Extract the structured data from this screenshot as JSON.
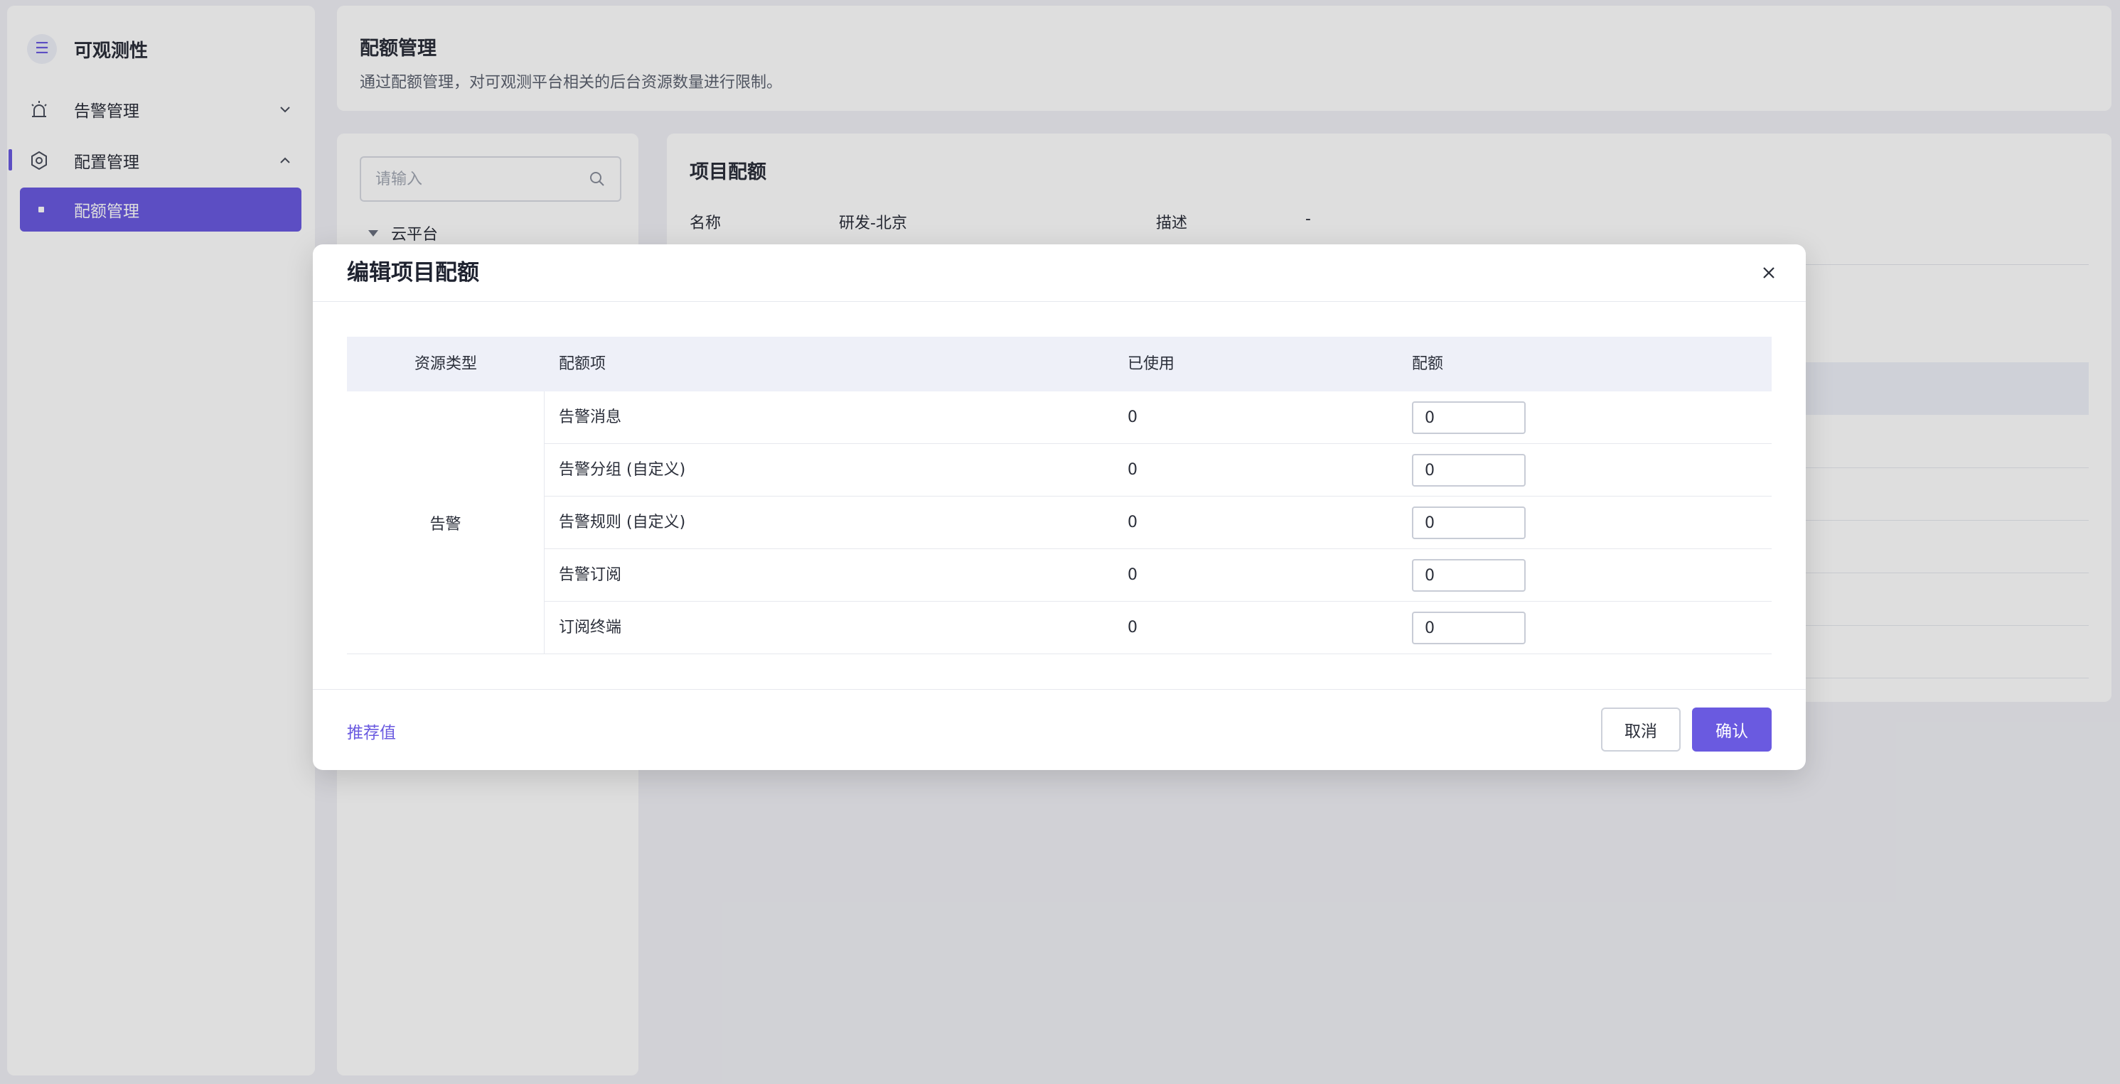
{
  "sidebar": {
    "brand_title": "可观测性",
    "items": [
      {
        "label": "告警管理",
        "icon": "alarm-icon",
        "expanded": false
      },
      {
        "label": "配置管理",
        "icon": "gear-icon",
        "expanded": true
      }
    ],
    "sub_items": [
      {
        "label": "配额管理",
        "active": true
      }
    ]
  },
  "header": {
    "title": "配额管理",
    "description": "通过配额管理，对可观测平台相关的后台资源数量进行限制。"
  },
  "tree": {
    "search_placeholder": "请输入",
    "root_label": "云平台"
  },
  "detail": {
    "title": "项目配额",
    "name_label": "名称",
    "name_value": "研发-北京",
    "desc_label": "描述",
    "desc_value": "-"
  },
  "modal": {
    "title": "编辑项目配额",
    "columns": {
      "type": "资源类型",
      "item": "配额项",
      "used": "已使用",
      "quota": "配额"
    },
    "resource_type": "告警",
    "rows": [
      {
        "item": "告警消息",
        "used": "0",
        "quota": "0"
      },
      {
        "item": "告警分组 (自定义)",
        "used": "0",
        "quota": "0"
      },
      {
        "item": "告警规则 (自定义)",
        "used": "0",
        "quota": "0"
      },
      {
        "item": "告警订阅",
        "used": "0",
        "quota": "0"
      },
      {
        "item": "订阅终端",
        "used": "0",
        "quota": "0"
      }
    ],
    "recommend_label": "推荐值",
    "cancel_label": "取消",
    "confirm_label": "确认"
  },
  "colors": {
    "accent": "#6a5ae0",
    "background": "#f0f1f6",
    "table_header": "#eef0f8"
  }
}
